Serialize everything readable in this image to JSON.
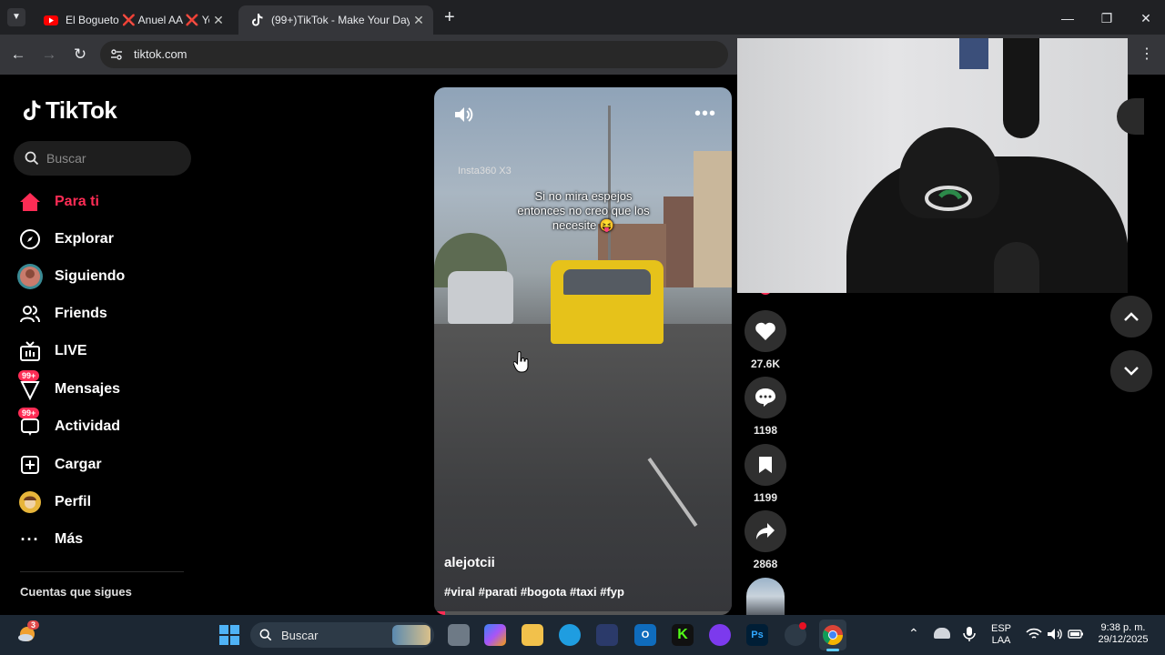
{
  "browser": {
    "tabs": [
      {
        "title": "El Bogueto ❌ Anuel AA ❌ Yo",
        "active": false
      },
      {
        "title": "(99+)TikTok - Make Your Day",
        "active": true
      }
    ],
    "url": "tiktok.com"
  },
  "sidebar": {
    "logo": "TikTok",
    "search_placeholder": "Buscar",
    "items": [
      {
        "label": "Para ti",
        "icon": "home-icon",
        "active": true
      },
      {
        "label": "Explorar",
        "icon": "compass-icon"
      },
      {
        "label": "Siguiendo",
        "icon": "avatar-icon"
      },
      {
        "label": "Friends",
        "icon": "friends-icon"
      },
      {
        "label": "LIVE",
        "icon": "live-icon"
      },
      {
        "label": "Mensajes",
        "icon": "messages-icon",
        "badge": "99+"
      },
      {
        "label": "Actividad",
        "icon": "activity-icon",
        "badge": "99+"
      },
      {
        "label": "Cargar",
        "icon": "upload-icon"
      },
      {
        "label": "Perfil",
        "icon": "profile-icon"
      },
      {
        "label": "Más",
        "icon": "more-icon"
      }
    ],
    "following_header": "Cuentas que sigues"
  },
  "video": {
    "watermark": "Insta360  X3",
    "caption": "Si no mira espejos entonces no creo que los necesite 😝",
    "author": "alejotcii",
    "hashtags": "#viral #parati #bogota #taxi #fyp"
  },
  "actions": {
    "likes": "27.6K",
    "comments": "1198",
    "saves": "1199",
    "shares": "2868"
  },
  "taskbar": {
    "search": "Buscar",
    "lang_top": "ESP",
    "lang_bottom": "LAA",
    "time": "9:38 p. m.",
    "date": "29/12/2025",
    "weather_badge": "3"
  },
  "colors": {
    "accent": "#fe2c55",
    "background": "#000000"
  }
}
